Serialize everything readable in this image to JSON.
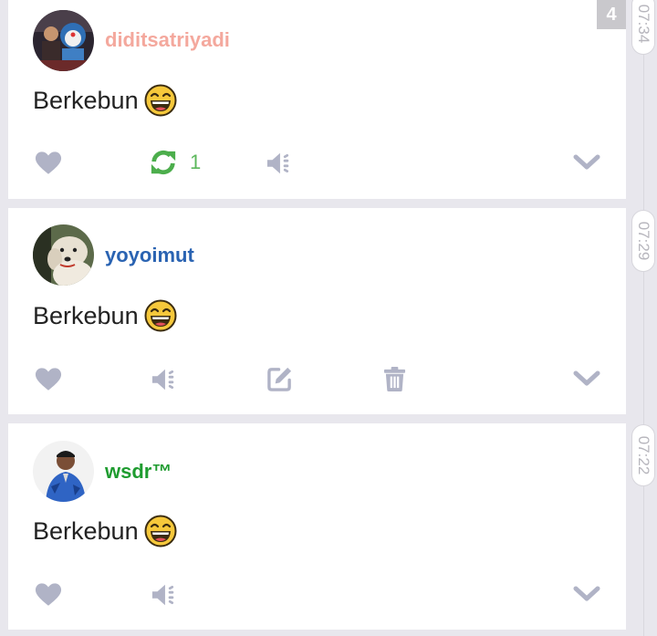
{
  "colors": {
    "background": "#e8e7ed",
    "icon_muted": "#b0b3c6",
    "repost_active": "#4cae4c",
    "user_pink": "#f4a89d",
    "user_blue": "#2a63b2",
    "user_green": "#1f9c30"
  },
  "unread_badge": "4",
  "posts": [
    {
      "username": "diditsatriyadi",
      "text": "Berkebun",
      "emoji": "grinning-emoji",
      "time": "07:34",
      "repost_count": "1",
      "actions": [
        "like-icon",
        "repost-icon",
        "mute-icon",
        "chevron-down-icon"
      ]
    },
    {
      "username": "yoyoimut",
      "text": "Berkebun",
      "emoji": "grinning-emoji",
      "time": "07:29",
      "actions": [
        "like-icon",
        "mute-icon",
        "edit-icon",
        "trash-icon",
        "chevron-down-icon"
      ]
    },
    {
      "username": "wsdr™",
      "text": "Berkebun",
      "emoji": "grinning-emoji",
      "time": "07:22",
      "actions": [
        "like-icon",
        "mute-icon",
        "chevron-down-icon"
      ]
    }
  ]
}
